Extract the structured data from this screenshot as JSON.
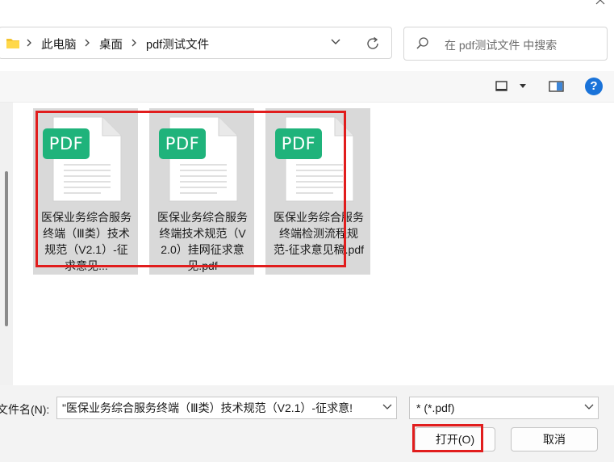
{
  "address": {
    "crumbs": [
      "此电脑",
      "桌面",
      "pdf测试文件"
    ]
  },
  "search": {
    "placeholder": "在 pdf测试文件 中搜索"
  },
  "toolbar": {
    "help_label": "?"
  },
  "files": [
    {
      "badge": "PDF",
      "name": "医保业务综合服务终端（Ⅲ类）技术规范（V2.1）-征求意见..."
    },
    {
      "badge": "PDF",
      "name": "医保业务综合服务终端技术规范（V2.0）挂网征求意见.pdf"
    },
    {
      "badge": "PDF",
      "name": "医保业务综合服务终端检测流程规范-征求意见稿.pdf"
    }
  ],
  "bottom": {
    "filename_label": "文件名(N):",
    "filename_value": "\"医保业务综合服务终端（Ⅲ类）技术规范（V2.1）-征求意!",
    "filetype_value": "* (*.pdf)",
    "open_label": "打开(O)",
    "cancel_label": "取消"
  },
  "colors": {
    "pdf_badge": "#1fb37b",
    "highlight": "#e11d1d",
    "help_icon": "#1a73d9",
    "folder": "#f4c430"
  }
}
